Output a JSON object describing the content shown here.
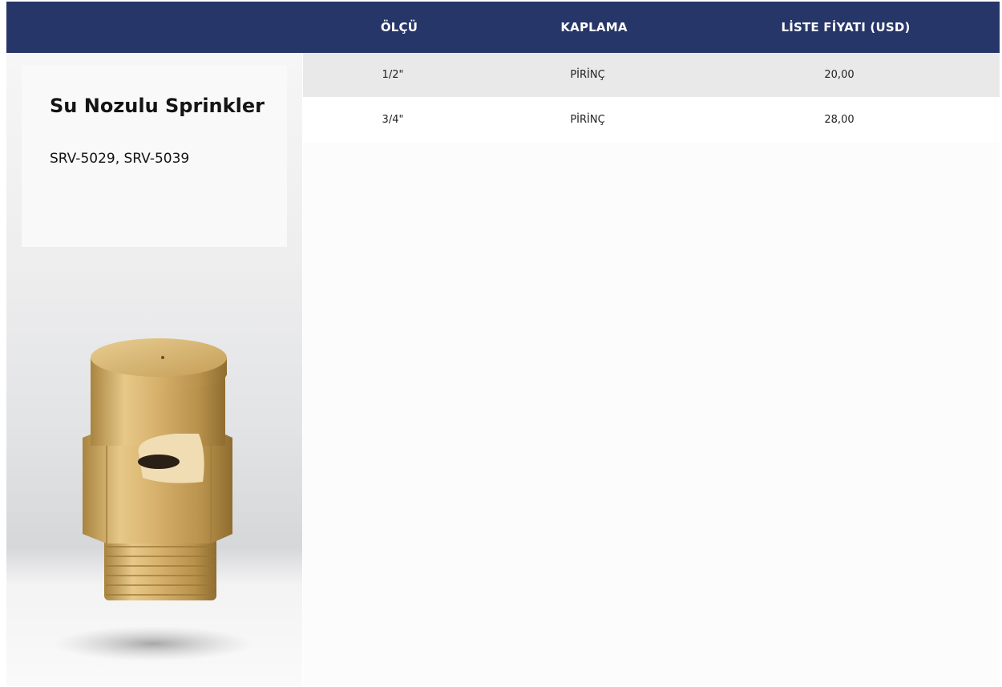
{
  "table": {
    "headers": {
      "size": "ÖLÇÜ",
      "coating": "KAPLAMA",
      "price": "LİSTE FİYATI (USD)"
    },
    "rows": [
      {
        "size": "1/2\"",
        "coating": "PİRİNÇ",
        "price": "20,00"
      },
      {
        "size": "3/4\"",
        "coating": "PİRİNÇ",
        "price": "28,00"
      }
    ]
  },
  "product": {
    "title": "Su Nozulu Sprinkler",
    "codes": "SRV-5029, SRV-5039",
    "image_icon": "brass-sprinkler-nozzle"
  },
  "colors": {
    "header_bg": "#273669",
    "header_text": "#ffffff",
    "row_shade": "#e9e9ea",
    "brass": "#c9a45a"
  }
}
